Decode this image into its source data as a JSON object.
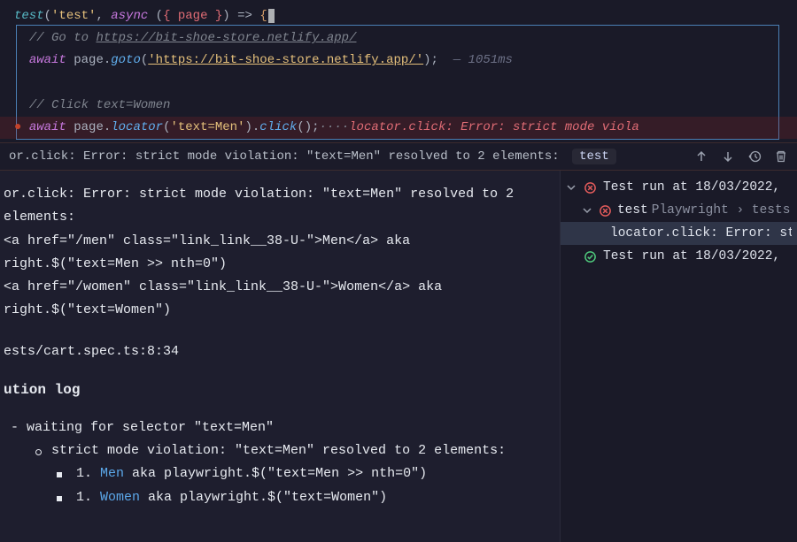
{
  "code": {
    "line1": "test('test', async ({ page }) => {",
    "l1_test": "test",
    "l1_str": "'test'",
    "l1_async": "async",
    "l1_param": "{ page }",
    "comment_goto_prefix": "// Go to ",
    "comment_goto_url": "https://bit-shoe-store.netlify.app/",
    "await": "await",
    "page": "page",
    "goto": "goto",
    "goto_url": "'https://bit-shoe-store.netlify.app/'",
    "goto_time": "— 1051ms",
    "comment_click": "// Click text=Women",
    "locator": "locator",
    "locator_arg": "'text=Men'",
    "click": "click",
    "click_err": "locator.click: Error: strict mode viola"
  },
  "errorbar": {
    "text": "or.click: Error: strict mode violation: \"text=Men\" resolved to 2 elements:",
    "pill": "test"
  },
  "details": {
    "line1": "or.click: Error: strict mode violation: \"text=Men\" resolved to 2 elements:",
    "line2": "<a href=\"/men\" class=\"link_link__38-U-\">Men</a> aka",
    "line3": "right.$(\"text=Men >> nth=0\")",
    "line4": "<a href=\"/women\" class=\"link_link__38-U-\">Women</a> aka",
    "line5": "right.$(\"text=Women\")",
    "location": "ests/cart.spec.ts:8:34",
    "heading": "ution log",
    "wait": "waiting for selector \"text=Men\"",
    "strict": "strict mode violation: \"text=Men\" resolved to 2 elements:",
    "men_pre": "1. ",
    "men_link": "Men",
    "men_post": " aka playwright.$(\"text=Men >> nth=0\")",
    "women_pre": "1. ",
    "women_link": "Women",
    "women_post": " aka playwright.$(\"text=Women\")"
  },
  "tree": {
    "run_fail": "Test run at 18/03/2022,",
    "test_label": "test",
    "test_sub": "Playwright › tests ›",
    "locator_err": "locator.click: Error: stric",
    "run_pass": "Test run at 18/03/2022,"
  }
}
